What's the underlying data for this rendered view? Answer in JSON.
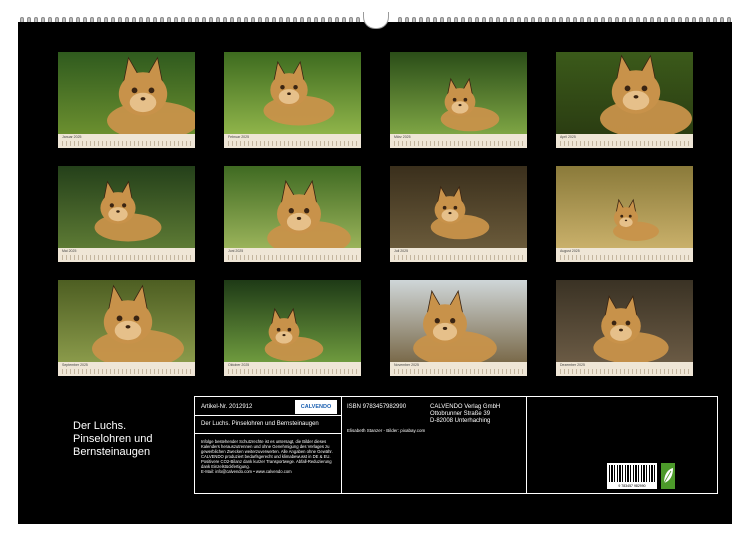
{
  "calendar": {
    "months": [
      {
        "label": "Januar 2025",
        "subject": "lynx-portrait"
      },
      {
        "label": "Februar 2025",
        "subject": "lynx-walking"
      },
      {
        "label": "März 2025",
        "subject": "lynx-pair-lying"
      },
      {
        "label": "April 2025",
        "subject": "lynx-yawning"
      },
      {
        "label": "Mai 2025",
        "subject": "lynx-on-branch"
      },
      {
        "label": "Juni 2025",
        "subject": "lynx-lying-portrait"
      },
      {
        "label": "Juli 2025",
        "subject": "lynx-in-hollow-log"
      },
      {
        "label": "August 2025",
        "subject": "lynx-in-grass"
      },
      {
        "label": "September 2025",
        "subject": "lynx-close-up"
      },
      {
        "label": "Oktober 2025",
        "subject": "lynx-cubs"
      },
      {
        "label": "November 2025",
        "subject": "lynx-in-snow"
      },
      {
        "label": "Dezember 2025",
        "subject": "lynx-crouching"
      }
    ]
  },
  "title": {
    "line1": "Der Luchs.",
    "line2": "Pinselohren und",
    "line3": "Bernsteinaugen"
  },
  "info": {
    "article": "Artikel-Nr. 2012912",
    "logo": "CALVENDO",
    "subtitle": "Der Luchs. Pinselohren und Bernsteinaugen",
    "legal": "Infolge bestehender Schutzrechte ist es untersagt, die Bilder dieses Kalenders herauszutrennen und ohne Genehmigung des Verlages zu gewerblichen Zwecken weiterzuverwerten. Alle Angaben ohne Gewähr. CALVENDO produziert bedarfsgerecht und klimabewusst in DE & EU. Positivere CO2-Bilanz dank kurzer Transportwege. Abfall-Reduzierung dank Einzelstückfertigung.",
    "email": "E-Mail: info@calvendo.com • www.calvendo.com",
    "isbn": "ISBN 9783457982990",
    "publisher1": "CALVENDO Verlag GmbH",
    "publisher2": "Ottobrunner Straße 39",
    "publisher3": "D-82008 Unterhaching",
    "credit": "Elisabeth Stanzer - Bilder: pixabay.com",
    "barcode_number": "9 783457 982990"
  },
  "colors": {
    "board": "#000000",
    "strip": "#efe6d6",
    "eco": "#4c9a2a"
  }
}
